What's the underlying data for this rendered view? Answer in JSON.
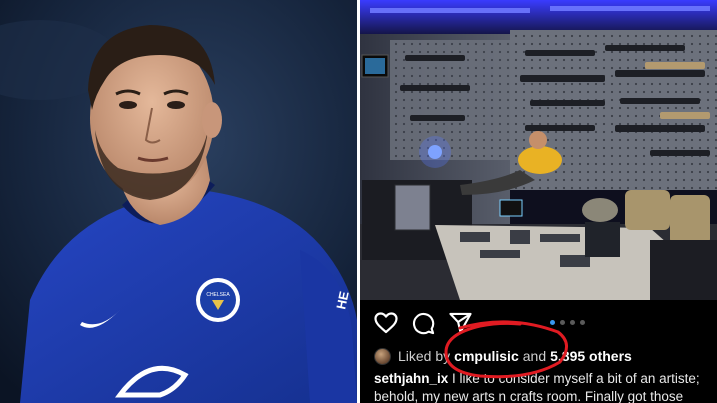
{
  "left_photo": {
    "subject": "player-portrait",
    "badge_text": "CHELSEA FOOTBALL CLUB",
    "sleeve_text": "HE"
  },
  "right_photo": {
    "subject": "room-with-gun-wall"
  },
  "instagram": {
    "icons": [
      "heart-icon",
      "comment-icon",
      "share-icon"
    ],
    "carousel": {
      "count": 4,
      "active": 0
    },
    "likes": {
      "prefix": "Liked by",
      "user": "cmpulisic",
      "suffix": "and",
      "others": "5,895 others"
    },
    "caption": {
      "username": "sethjahn_ix",
      "line1": "I like to consider myself a bit of an artiste;",
      "line2": "behold, my new arts n crafts room. Finally got those"
    },
    "highlight_color": "#e01b22",
    "link_color": "#3897f0"
  },
  "colors": {
    "jersey_blue": "#1b3aa8",
    "neon_blue": "#3a3cff"
  }
}
